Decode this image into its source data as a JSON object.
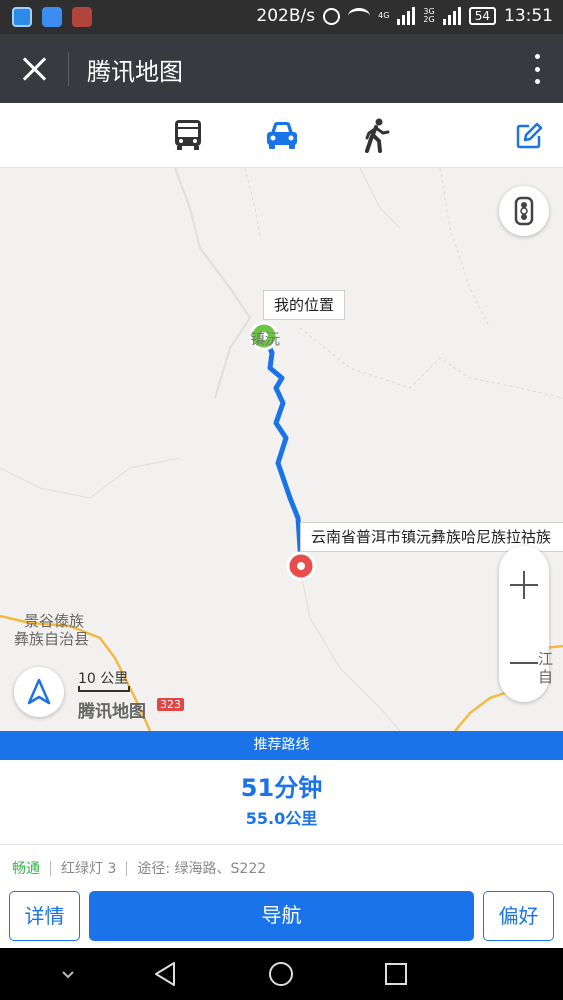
{
  "status_bar": {
    "speed": "202B/s",
    "signal_left": "4G",
    "signal_right_top": "3G",
    "signal_right_bottom": "2G",
    "battery": "54",
    "time": "13:51"
  },
  "title_bar": {
    "title": "腾讯地图"
  },
  "modes": {
    "selected": "car",
    "active_color": "#1a73e8",
    "inactive_color": "#333333"
  },
  "map": {
    "start_label": "我的位置",
    "start_place_fragment": "镇沅",
    "destination_label": "云南省普洱市镇沅彝族哈尼族拉祜族",
    "place_jinggu_line1": "景谷傣族",
    "place_jinggu_line2": "彝族自治县",
    "place_right_line1": "江",
    "place_right_line2": "自",
    "scale_label": "10 公里",
    "logo_text": "腾讯地图",
    "highway_badge": "323",
    "route_color": "#1a73e8",
    "start_color": "#6cc644",
    "dest_color": "#ea4c4c"
  },
  "route": {
    "header": "推荐路线",
    "duration": "51分钟",
    "distance": "55.0公里",
    "traffic_status": "畅通",
    "traffic_lights": "红绿灯 3",
    "via": "途径: 绿海路、S222"
  },
  "buttons": {
    "detail": "详情",
    "navigate": "导航",
    "preference": "偏好"
  }
}
